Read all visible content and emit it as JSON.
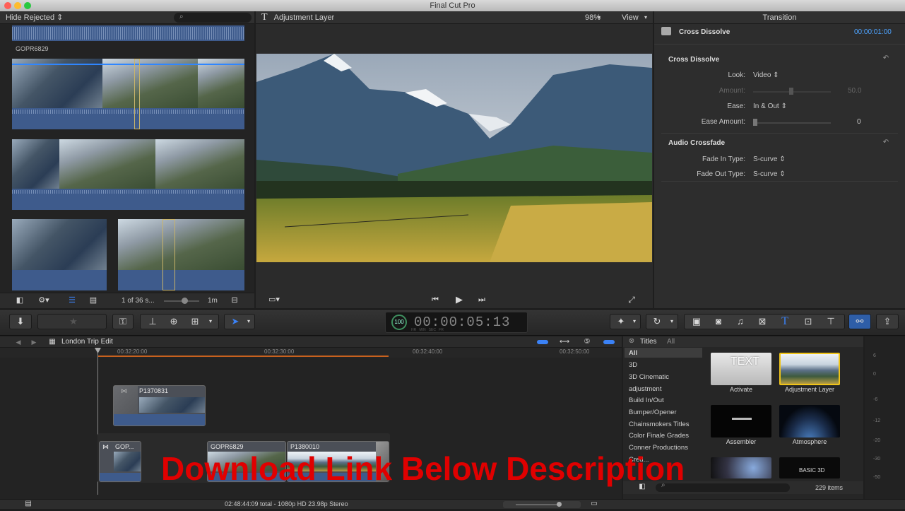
{
  "window": {
    "title": "Final Cut Pro"
  },
  "browser": {
    "filter": "Hide Rejected",
    "clip_label": "GOPR6829",
    "count": "1 of 36 s...",
    "duration": "1m"
  },
  "viewer": {
    "title": "Adjustment Layer",
    "zoom": "98%",
    "view_menu": "View"
  },
  "inspector": {
    "tab": "Transition",
    "name": "Cross Dissolve",
    "timecode": "00:00:01:00",
    "section1": "Cross Dissolve",
    "look_label": "Look:",
    "look_value": "Video",
    "amount_label": "Amount:",
    "amount_value": "50.0",
    "ease_label": "Ease:",
    "ease_value": "In & Out",
    "ease_amount_label": "Ease Amount:",
    "ease_amount_value": "0",
    "section2": "Audio Crossfade",
    "fade_in_label": "Fade In Type:",
    "fade_in_value": "S-curve",
    "fade_out_label": "Fade Out Type:",
    "fade_out_value": "S-curve"
  },
  "toolbar": {
    "timecode_small": "100",
    "timecode": "00:00:05:13",
    "timecode_units": "HR   MIN   SEC   FR"
  },
  "timeline": {
    "project": "London Trip Edit",
    "ruler": [
      "00:32:20:00",
      "00:32:30:00",
      "00:32:40:00",
      "00:32:50:00"
    ],
    "clips": {
      "connected": "P1370831",
      "a": "GOP...",
      "b": "GOPR6829",
      "c": "P1380010"
    },
    "status": "02:48:44:09 total - 1080p HD 23.98p Stereo"
  },
  "titles_browser": {
    "header": "Titles",
    "scope": "All",
    "categories": [
      "All",
      "3D",
      "3D Cinematic",
      "adjustment",
      "Build In/Out",
      "Bumper/Opener",
      "Chainsmokers Titles",
      "Color Finale Grades",
      "Conner Productions",
      "Cred..."
    ],
    "tiles": [
      {
        "label": "Activate",
        "art": "TEXT"
      },
      {
        "label": "Adjustment Layer",
        "art": ""
      },
      {
        "label": "Assembler",
        "art": ""
      },
      {
        "label": "Atmosphere",
        "art": ""
      },
      {
        "label": "",
        "art": ""
      },
      {
        "label": "",
        "art": "BASIC 3D"
      }
    ],
    "count": "229 items"
  },
  "meters": [
    "6",
    "0",
    "-6",
    "-12",
    "-20",
    "-30",
    "-50"
  ],
  "overlay": {
    "watermark": "Download Link Below Description"
  },
  "colors": {
    "accent": "#3b82f6",
    "clip_blue": "#3e5b8c",
    "playhead": "#e07a2f",
    "watermark": "#e00000"
  }
}
